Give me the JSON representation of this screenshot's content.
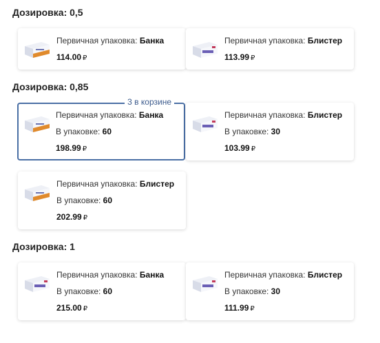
{
  "groups": [
    {
      "title": "Дозировка: 0,5",
      "cards": [
        {
          "pack_label": "Первичная упаковка: ",
          "pack_value": "Банка",
          "price": "114.00",
          "currency": "₽"
        },
        {
          "pack_label": "Первичная упаковка: ",
          "pack_value": "Блистер",
          "price": "113.99",
          "currency": "₽"
        }
      ]
    },
    {
      "title": "Дозировка: 0,85",
      "cards": [
        {
          "pack_label": "Первичная упаковка: ",
          "pack_value": "Банка",
          "qty_label": "В упаковке: ",
          "qty_value": "60",
          "price": "198.99",
          "currency": "₽",
          "badge": "3 в корзине"
        },
        {
          "pack_label": "Первичная упаковка: ",
          "pack_value": "Блистер",
          "qty_label": "В упаковке: ",
          "qty_value": "30",
          "price": "103.99",
          "currency": "₽"
        },
        {
          "pack_label": "Первичная упаковка: ",
          "pack_value": "Блистер",
          "qty_label": "В упаковке: ",
          "qty_value": "60",
          "price": "202.99",
          "currency": "₽"
        }
      ]
    },
    {
      "title": "Дозировка: 1",
      "cards": [
        {
          "pack_label": "Первичная упаковка: ",
          "pack_value": "Банка",
          "qty_label": "В упаковке: ",
          "qty_value": "60",
          "price": "215.00",
          "currency": "₽"
        },
        {
          "pack_label": "Первичная упаковка: ",
          "pack_value": "Блистер",
          "qty_label": "В упаковке: ",
          "qty_value": "30",
          "price": "111.99",
          "currency": "₽"
        }
      ]
    }
  ],
  "colors": {
    "selected_border": "#4a6fa5",
    "badge_text": "#3b5a8c"
  },
  "icons": {
    "product": "medicine-box-icon"
  }
}
